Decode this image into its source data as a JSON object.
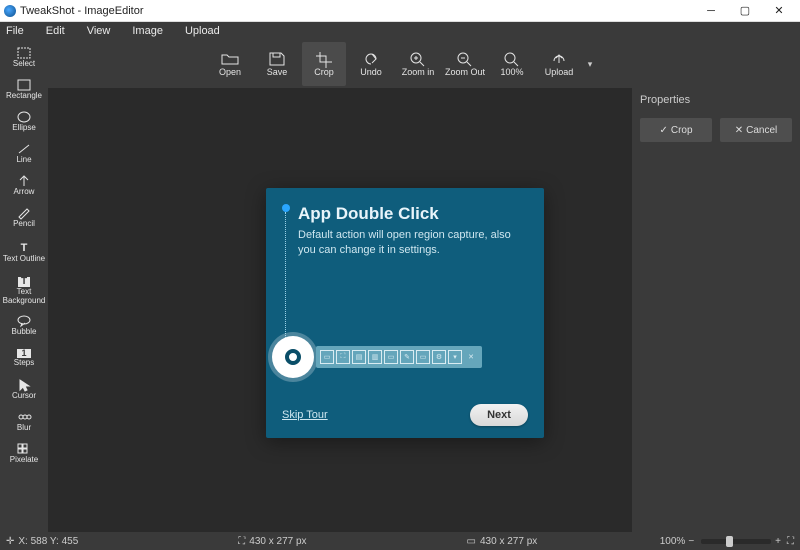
{
  "window": {
    "title": "TweakShot - ImageEditor"
  },
  "menu": [
    "File",
    "Edit",
    "View",
    "Image",
    "Upload"
  ],
  "sidebar": [
    {
      "label": "Select"
    },
    {
      "label": "Rectangle"
    },
    {
      "label": "Ellipse"
    },
    {
      "label": "Line"
    },
    {
      "label": "Arrow"
    },
    {
      "label": "Pencil"
    },
    {
      "label": "Text Outline"
    },
    {
      "label": "Text Background"
    },
    {
      "label": "Bubble"
    },
    {
      "label": "Steps"
    },
    {
      "label": "Cursor"
    },
    {
      "label": "Blur"
    },
    {
      "label": "Pixelate"
    }
  ],
  "toolbar": {
    "open": "Open",
    "save": "Save",
    "crop": "Crop",
    "undo": "Undo",
    "zoomin": "Zoom in",
    "zoomout": "Zoom Out",
    "hundred": "100%",
    "upload": "Upload"
  },
  "properties": {
    "title": "Properties",
    "crop": "Crop",
    "cancel": "Cancel"
  },
  "dialog": {
    "title": "App Double Click",
    "body": "Default action will open region capture, also you can change it in settings.",
    "skip": "Skip Tour",
    "next": "Next"
  },
  "status": {
    "coords": "X: 588 Y: 455",
    "dim1": "430 x 277 px",
    "dim2": "430 x 277 px",
    "zoom": "100%"
  }
}
